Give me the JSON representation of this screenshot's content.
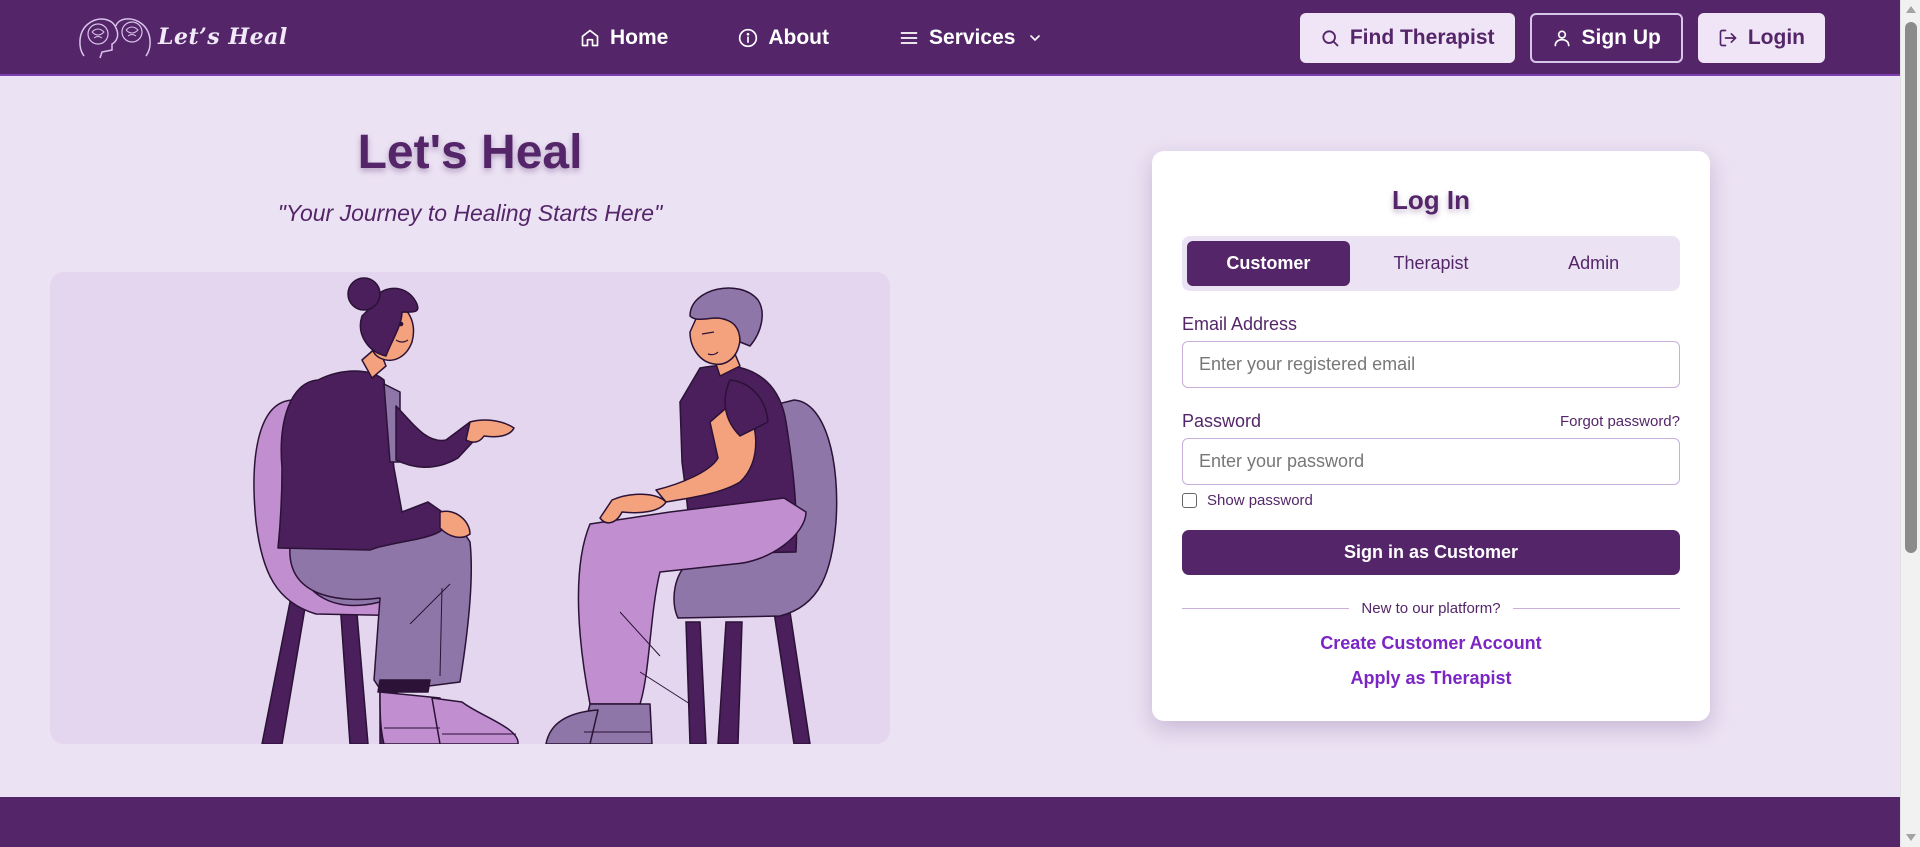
{
  "app": {
    "name": "Let's Heal"
  },
  "nav": {
    "logo_text": "Let’s Heal",
    "links": [
      {
        "label": "Home",
        "icon": "home-icon"
      },
      {
        "label": "About",
        "icon": "info-icon"
      },
      {
        "label": "Services",
        "icon": "menu-icon"
      }
    ],
    "buttons": [
      {
        "label": "Find Therapist",
        "icon": "search-icon"
      },
      {
        "label": "Sign Up",
        "icon": "user-icon"
      },
      {
        "label": "Login",
        "icon": "login-icon"
      }
    ]
  },
  "hero": {
    "title": "Let's Heal",
    "tagline": "\"Your Journey to Healing Starts Here\""
  },
  "login": {
    "title": "Log In",
    "tabs": [
      {
        "label": "Customer",
        "active": true
      },
      {
        "label": "Therapist",
        "active": false
      },
      {
        "label": "Admin",
        "active": false
      }
    ],
    "email_label": "Email Address",
    "email_placeholder": "Enter your registered email",
    "email_value": "",
    "password_label": "Password",
    "forgot_label": "Forgot password?",
    "password_placeholder": "Enter your password",
    "password_value": "",
    "show_password_label": "Show password",
    "show_password_checked": false,
    "submit_label": "Sign in as Customer",
    "divider_text": "New to our platform?",
    "create_account_label": "Create Customer Account",
    "apply_therapist_label": "Apply as Therapist"
  },
  "colors": {
    "primary": "#542669",
    "background": "#ebe2f3",
    "illustration_bg": "#e3d6ee",
    "link": "#7b26c4",
    "chair_left": "#c18fd0",
    "chair_right": "#8b74a8"
  }
}
